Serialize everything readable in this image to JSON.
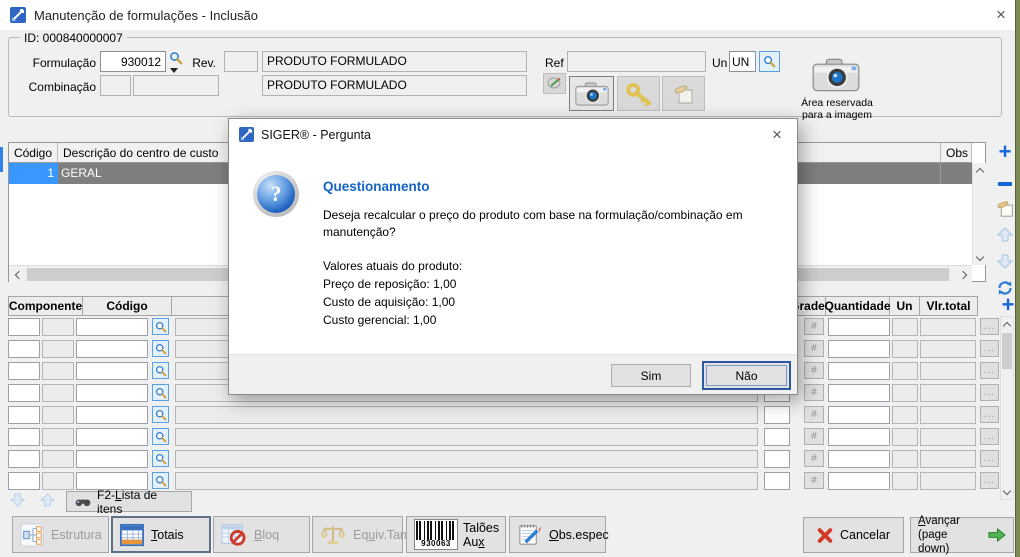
{
  "window": {
    "title": "Manutenção de formulações - Inclusão",
    "close_label": "×"
  },
  "header": {
    "group_title": "ID: 000840000007",
    "formulacao": {
      "label": "Formulação",
      "value": "930012"
    },
    "rev": {
      "label": "Rev.",
      "value": ""
    },
    "produto_desc_1": "PRODUTO FORMULADO",
    "combinacao": {
      "label": "Combinação",
      "value1": "",
      "value2": ""
    },
    "produto_desc_2": "PRODUTO FORMULADO",
    "ref": {
      "label": "Ref",
      "value": ""
    },
    "un": {
      "label": "Un",
      "value": "UN"
    },
    "image_area": {
      "line1": "Área reservada",
      "line2": "para a imagem"
    }
  },
  "icons": {
    "app": "siger-logo-arrow",
    "search": "magnifier",
    "note": "note-pencil",
    "camera": "camera",
    "key": "key",
    "paste": "paste-hand",
    "add": "+",
    "remove": "−",
    "move_up": "arrow-up",
    "move_down": "arrow-down",
    "refresh": "refresh-arrows",
    "binoculars": "binoculars",
    "structure": "org-chart",
    "totals": "table-grid",
    "block": "table-no-entry",
    "scale": "balance-scale",
    "barcode": "barcode",
    "notepad": "notepad-pencil",
    "cancel": "red-x",
    "forward": "green-arrow",
    "question": "question-sphere"
  },
  "cost_table": {
    "columns": [
      "Código",
      "Descrição do centro de custo",
      "",
      "Obs"
    ],
    "rows": [
      {
        "codigo": "1",
        "descricao": "GERAL"
      }
    ]
  },
  "items_table": {
    "headers": [
      "Componente",
      "Código",
      "",
      "Grade",
      "Quantidade",
      "Un",
      "Vlr.total"
    ],
    "visible_rows": 8,
    "hash_label": "#",
    "more_label": "..."
  },
  "dialog": {
    "title": "SIGER® - Pergunta",
    "close_label": "×",
    "heading": "Questionamento",
    "question": "Deseja recalcular o preço do produto com base na formulação/combinação em manutenção?",
    "values_intro": "Valores atuais do produto:",
    "value_lines": [
      "Preço de reposição: 1,00",
      "Custo de aquisição: 1,00",
      "Custo gerencial: 1,00"
    ],
    "yes_label": "Sim",
    "no_label": "Não"
  },
  "footer": {
    "f2_tab": {
      "pre": "F2-",
      "u": "L",
      "post": "ista de itens"
    },
    "estrutura_label": "Estrutura",
    "totais": {
      "pre": "",
      "u": "T",
      "post": "otais"
    },
    "bloq": {
      "pre": "",
      "u": "B",
      "post": "loq"
    },
    "equiv": {
      "pre": "Eq",
      "u": "u",
      "post": "iv.Tam"
    },
    "taloes": {
      "pre": "Talões Au",
      "u": "x",
      "post": ""
    },
    "barcode_number": "930063",
    "obs": {
      "pre": "",
      "u": "O",
      "post": "bs.espec"
    },
    "cancelar_label": "Cancelar",
    "avancar": {
      "pre": "",
      "u": "A",
      "post": "vançar",
      "line2": "(page down)"
    }
  },
  "colors": {
    "accent_blue": "#1766d8",
    "selection_blue": "#3898ff",
    "selection_gray": "#7f7f7f",
    "heading_blue": "#1464c8",
    "focus_border": "#2d5a9e",
    "desktop_edge": "#7d8b52",
    "window_bg": "#f0f0f0",
    "titlebar_bg": "#ffffff"
  }
}
